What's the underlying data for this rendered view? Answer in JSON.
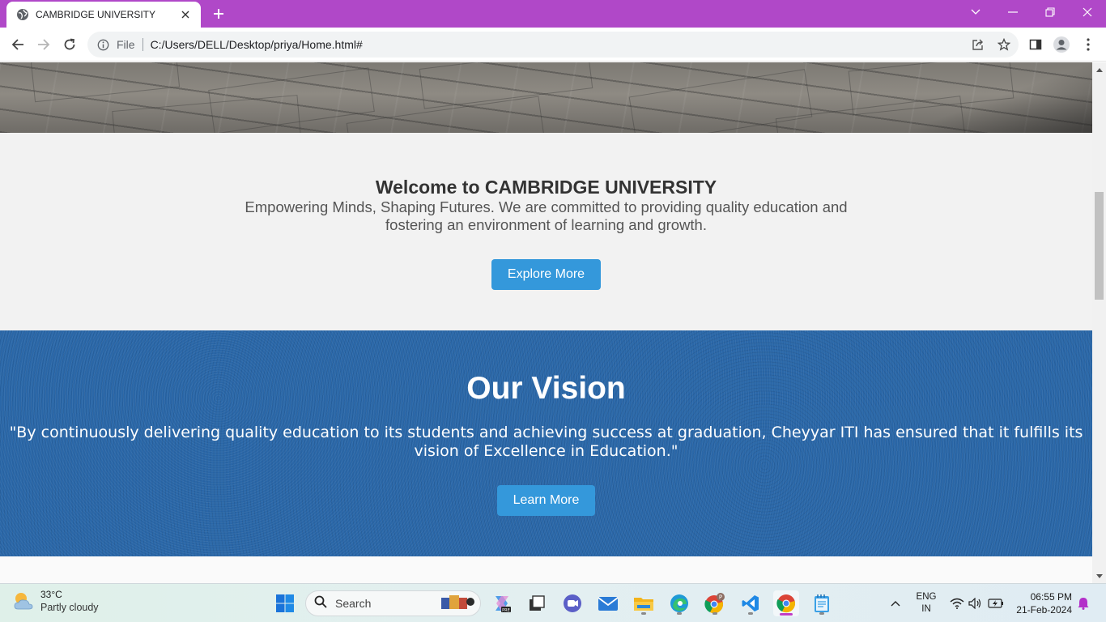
{
  "browser": {
    "tab_title": "CAMBRIDGE UNIVERSITY",
    "address_scheme_label": "File",
    "address_url": "C:/Users/DELL/Desktop/priya/Home.html#",
    "accent_color": "#b048c8"
  },
  "page": {
    "welcome": {
      "title": "Welcome to CAMBRIDGE UNIVERSITY",
      "text": "Empowering Minds, Shaping Futures. We are committed to providing quality education and fostering an environment of learning and growth.",
      "button_label": "Explore More"
    },
    "vision": {
      "title": "Our Vision",
      "quote": "\"By continuously delivering quality education to its students and achieving success at graduation, Cheyyar ITI has ensured that it fulfills its vision of Excellence in Education.\"",
      "button_label": "Learn More",
      "background_color": "#2a67a8"
    },
    "button_color": "#3498db"
  },
  "taskbar": {
    "weather_temp": "33°C",
    "weather_desc": "Partly cloudy",
    "search_placeholder": "Search",
    "lang_primary": "ENG",
    "lang_secondary": "IN",
    "time": "06:55 PM",
    "date": "21-Feb-2024",
    "apps": [
      "start-icon",
      "copilot-icon",
      "task-view-icon",
      "teams-icon",
      "mail-icon",
      "file-explorer-icon",
      "edge-icon",
      "chrome-profile-icon",
      "vscode-icon",
      "chrome-icon",
      "notepad-icon"
    ]
  }
}
